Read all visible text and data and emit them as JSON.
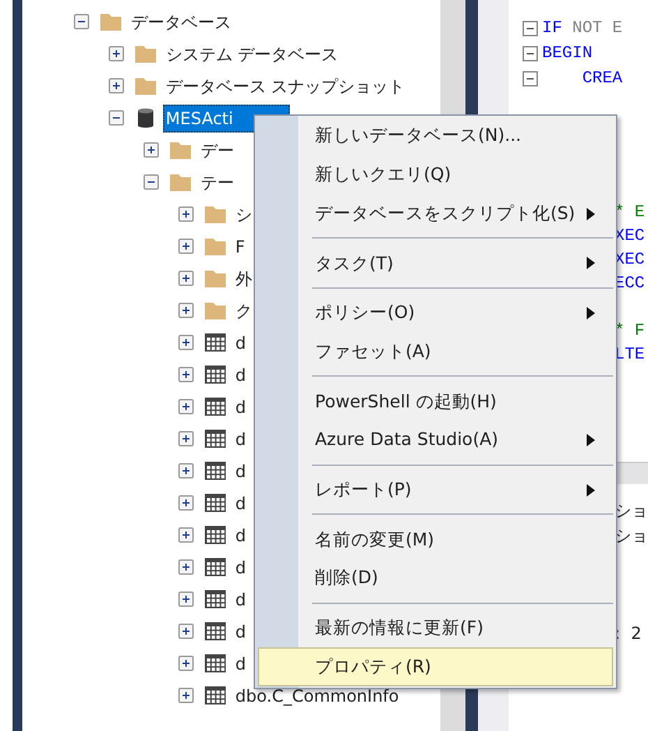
{
  "tree": [
    {
      "label": "データベース",
      "kind": "folder",
      "expanded": true,
      "selected": false,
      "children": [
        {
          "label": "システム データベース",
          "kind": "folder",
          "expanded": false,
          "selected": false
        },
        {
          "label": "データベース スナップショット",
          "kind": "folder",
          "expanded": false,
          "selected": false
        },
        {
          "label": "MESActi",
          "kind": "database",
          "expanded": true,
          "selected": true,
          "children": [
            {
              "label": "デー",
              "kind": "folder",
              "expanded": false,
              "selected": false
            },
            {
              "label": "テー",
              "kind": "folder",
              "expanded": true,
              "selected": false,
              "children": [
                {
                  "label": "シ",
                  "kind": "folder",
                  "expanded": false,
                  "selected": false
                },
                {
                  "label": "F",
                  "kind": "folder",
                  "expanded": false,
                  "selected": false
                },
                {
                  "label": "外",
                  "kind": "folder",
                  "expanded": false,
                  "selected": false
                },
                {
                  "label": "ク",
                  "kind": "folder",
                  "expanded": false,
                  "selected": false
                },
                {
                  "label": "d",
                  "kind": "table",
                  "expanded": false,
                  "selected": false
                },
                {
                  "label": "d",
                  "kind": "table",
                  "expanded": false,
                  "selected": false
                },
                {
                  "label": "d",
                  "kind": "table",
                  "expanded": false,
                  "selected": false
                },
                {
                  "label": "d",
                  "kind": "table",
                  "expanded": false,
                  "selected": false
                },
                {
                  "label": "d",
                  "kind": "table",
                  "expanded": false,
                  "selected": false
                },
                {
                  "label": "d",
                  "kind": "table",
                  "expanded": false,
                  "selected": false
                },
                {
                  "label": "d",
                  "kind": "table",
                  "expanded": false,
                  "selected": false
                },
                {
                  "label": "d",
                  "kind": "table",
                  "expanded": false,
                  "selected": false
                },
                {
                  "label": "d",
                  "kind": "table",
                  "expanded": false,
                  "selected": false
                },
                {
                  "label": "d",
                  "kind": "table",
                  "expanded": false,
                  "selected": false
                },
                {
                  "label": "d",
                  "kind": "table",
                  "expanded": false,
                  "selected": false
                },
                {
                  "label": "dbo.C_CommonInfo",
                  "kind": "table",
                  "expanded": false,
                  "selected": false
                }
              ]
            }
          ]
        }
      ]
    }
  ],
  "context_menu": [
    {
      "kind": "item",
      "label": "新しいデータベース(N)...",
      "submenu": false,
      "selected": false
    },
    {
      "kind": "item",
      "label": "新しいクエリ(Q)",
      "submenu": false,
      "selected": false
    },
    {
      "kind": "item",
      "label": "データベースをスクリプト化(S)",
      "submenu": true,
      "selected": false
    },
    {
      "kind": "separator"
    },
    {
      "kind": "item",
      "label": "タスク(T)",
      "submenu": true,
      "selected": false
    },
    {
      "kind": "separator"
    },
    {
      "kind": "item",
      "label": "ポリシー(O)",
      "submenu": true,
      "selected": false
    },
    {
      "kind": "item",
      "label": "ファセット(A)",
      "submenu": false,
      "selected": false
    },
    {
      "kind": "separator"
    },
    {
      "kind": "item",
      "label": "PowerShell の起動(H)",
      "submenu": false,
      "selected": false
    },
    {
      "kind": "item",
      "label": "Azure Data Studio(A)",
      "submenu": true,
      "selected": false
    },
    {
      "kind": "separator"
    },
    {
      "kind": "item",
      "label": "レポート(P)",
      "submenu": true,
      "selected": false
    },
    {
      "kind": "separator"
    },
    {
      "kind": "item",
      "label": "名前の変更(M)",
      "submenu": false,
      "selected": false
    },
    {
      "kind": "item",
      "label": "削除(D)",
      "submenu": false,
      "selected": false
    },
    {
      "kind": "separator"
    },
    {
      "kind": "item",
      "label": "最新の情報に更新(F)",
      "submenu": false,
      "selected": false
    },
    {
      "kind": "item",
      "label": "プロパティ(R)",
      "submenu": false,
      "selected": true
    }
  ],
  "editor": {
    "blocks": [
      [
        {
          "fold": true,
          "tokens": [
            {
              "kind": "keyword",
              "text": "IF"
            },
            {
              "kind": "plain",
              "text": " NOT E"
            }
          ]
        },
        {
          "fold": true,
          "tokens": [
            {
              "kind": "keyword",
              "text": "BEGIN"
            }
          ]
        },
        {
          "fold": true,
          "tokens": [
            {
              "kind": "keyword",
              "text": "    CREA"
            }
          ]
        }
      ],
      [
        {
          "fold": false,
          "tokens": [
            {
              "kind": "comment",
              "text": "* E"
            }
          ]
        },
        {
          "fold": false,
          "tokens": [
            {
              "kind": "keyword",
              "text": "XEC"
            }
          ]
        },
        {
          "fold": false,
          "tokens": [
            {
              "kind": "keyword",
              "text": "XEC"
            }
          ]
        },
        {
          "fold": false,
          "tokens": [
            {
              "kind": "keyword",
              "text": "ECC"
            }
          ]
        }
      ],
      [
        {
          "fold": false,
          "tokens": [
            {
              "kind": "comment",
              "text": "* F"
            }
          ]
        },
        {
          "fold": false,
          "tokens": [
            {
              "kind": "keyword",
              "text": "LTE"
            }
          ]
        }
      ]
    ],
    "output": [
      "ショ",
      "ショ",
      ":  2"
    ]
  }
}
